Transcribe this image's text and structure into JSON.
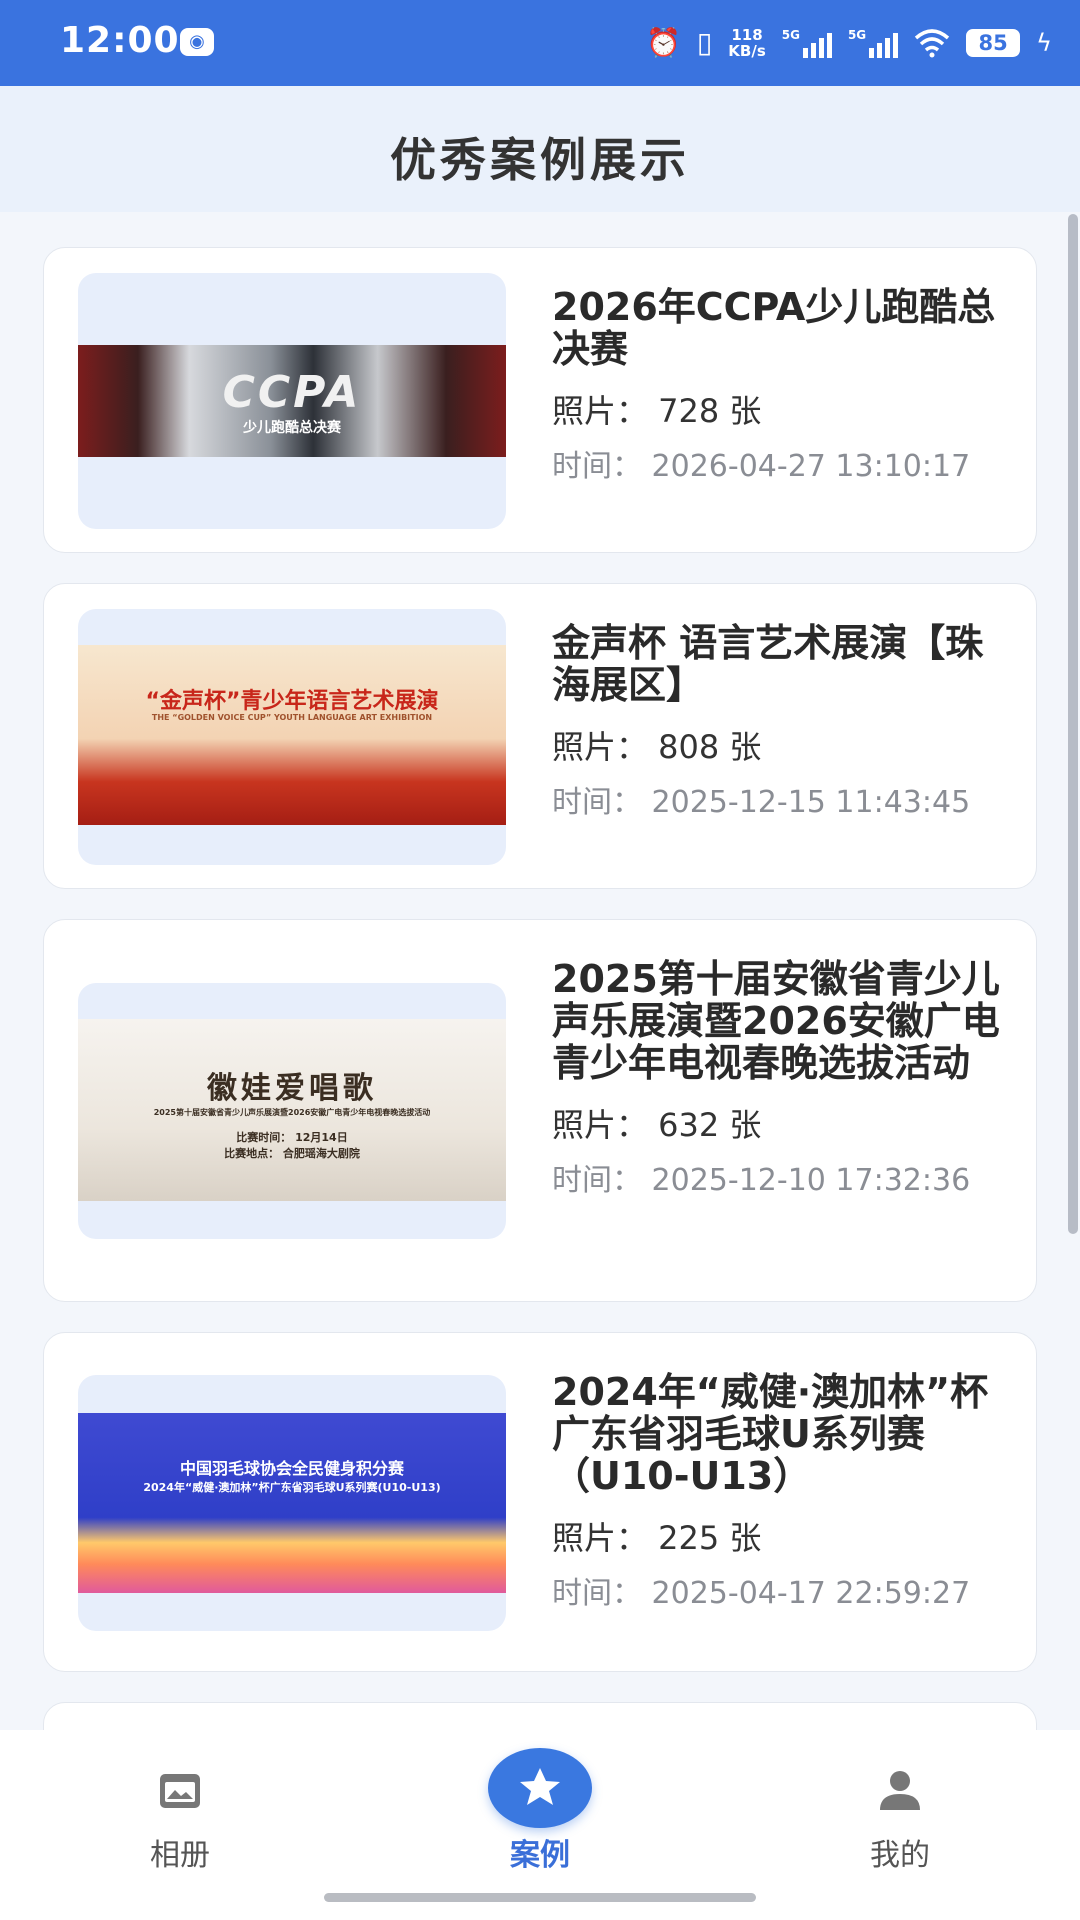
{
  "status_bar": {
    "time": "12:00",
    "net_speed_value": "118",
    "net_speed_unit": "KB/s",
    "network_1": "5G",
    "network_2": "5G",
    "battery": "85",
    "icons": [
      "wechat-icon",
      "alarm-icon",
      "vibrate-icon",
      "signal-icon",
      "wifi-icon",
      "battery-icon",
      "charging-icon"
    ]
  },
  "header": {
    "title": "优秀案例展示"
  },
  "cases": [
    {
      "title": "2026年CCPA少儿跑酷总决赛",
      "photos": "照片：  728 张",
      "time": "时间：  2026-04-27 13:10:17"
    },
    {
      "title": "金声杯 语言艺术展演【珠海展区】",
      "photos": "照片：  808 张",
      "time": "时间：  2025-12-15 11:43:45"
    },
    {
      "title": "2025第十届安徽省青少儿声乐展演暨2026安徽广电青少年电视春晚选拔活动",
      "photos": "照片：  632 张",
      "time": "时间：  2025-12-10 17:32:36"
    },
    {
      "title": "2024年“威健·澳加林”杯广东省羽毛球U系列赛（U10-U13）",
      "photos": "照片：  225 张",
      "time": "时间：  2025-04-17 22:59:27"
    }
  ],
  "posters": {
    "p1": {
      "headline": "CCPA",
      "sub": "少儿跑酷总决赛"
    },
    "p2": {
      "headline": "“金声杯”青少年语言艺术展演",
      "sub": "THE “GOLDEN VOICE CUP” YOUTH LANGUAGE ART EXHIBITION"
    },
    "p3": {
      "headline": "徽娃爱唱歌",
      "sub": "2025第十届安徽省青少儿声乐展演暨2026安徽广电青少年电视春晚选拔活动",
      "line1": "比赛时间：  12月14日",
      "line2": "比赛地点：  合肥瑶海大剧院"
    },
    "p4": {
      "headline": "中国羽毛球协会全民健身积分赛",
      "sub": "2024年“威健·澳加林”杯广东省羽毛球U系列赛(U10-U13)"
    }
  },
  "tabbar": {
    "tabs": [
      {
        "label": "相册",
        "icon": "album-icon",
        "active": false
      },
      {
        "label": "案例",
        "icon": "star-icon",
        "active": true
      },
      {
        "label": "我的",
        "icon": "user-icon",
        "active": false
      }
    ]
  },
  "colors": {
    "accent": "#3a73df",
    "active_tab": "#3a6fd8",
    "page_bg": "#f3f6fb"
  }
}
